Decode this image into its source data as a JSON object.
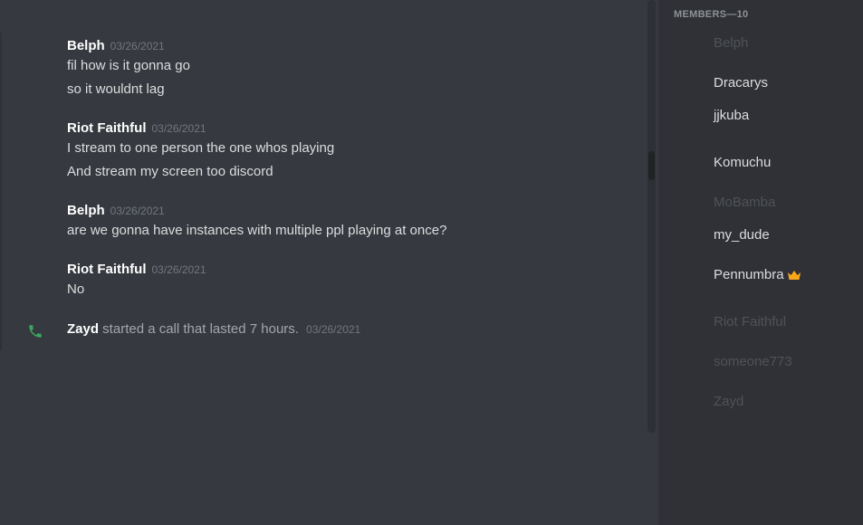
{
  "messages": [
    {
      "author": "Belph",
      "timestamp": "03/26/2021",
      "lines": [
        "fil how is it gonna go",
        "so it wouldnt lag"
      ]
    },
    {
      "author": "Riot Faithful",
      "timestamp": "03/26/2021",
      "lines": [
        "I stream to one person the one whos playing",
        "And stream my screen too discord"
      ]
    },
    {
      "author": "Belph",
      "timestamp": "03/26/2021",
      "lines": [
        "are we gonna have instances with multiple ppl playing at once?"
      ]
    },
    {
      "author": "Riot Faithful",
      "timestamp": "03/26/2021",
      "lines": [
        "No"
      ]
    }
  ],
  "call": {
    "caller": "Zayd",
    "text": " started a call that lasted 7 hours.",
    "timestamp": "03/26/2021"
  },
  "members": {
    "header": "MEMBERS—10",
    "list": [
      {
        "name": "Belph",
        "status": "offline"
      },
      {
        "name": "Dracarys",
        "status": "online"
      },
      {
        "name": "jjkuba",
        "status": "online"
      },
      {
        "name": "Komuchu",
        "status": "online"
      },
      {
        "name": "MoBamba",
        "status": "offline"
      },
      {
        "name": "my_dude",
        "status": "online"
      },
      {
        "name": "Pennumbra",
        "status": "online",
        "owner": true
      },
      {
        "name": "Riot Faithful",
        "status": "offline"
      },
      {
        "name": "someone773",
        "status": "offline"
      },
      {
        "name": "Zayd",
        "status": "offline"
      }
    ]
  },
  "icons": {
    "call": "phone-icon",
    "owner": "crown-icon"
  },
  "colors": {
    "call_icon": "#3ba55c",
    "crown": "#faa61a",
    "author": "#ffffff",
    "text": "#dcddde"
  }
}
